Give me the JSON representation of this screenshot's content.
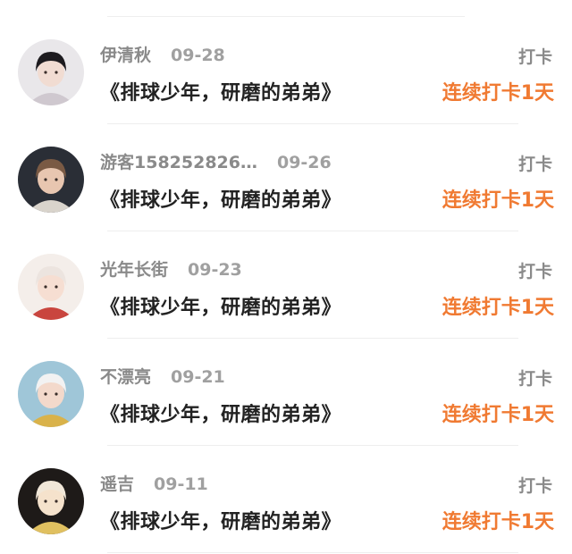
{
  "entries": [
    {
      "name": "伊清秋",
      "date": "09-28",
      "title": "《排球少年，研磨的弟弟》",
      "action": "打卡",
      "streak": "连续打卡1天",
      "avatar": {
        "icon": "avatar-dark-hair-man",
        "bg": "#e9e7ea",
        "hair": "#1d1b1f",
        "skin": "#f1dcd2",
        "cloth": "#cfc8cf"
      }
    },
    {
      "name": "游客158252826…",
      "date": "09-26",
      "title": "《排球少年，研磨的弟弟》",
      "action": "打卡",
      "streak": "连续打卡1天",
      "avatar": {
        "icon": "avatar-long-hair-woman",
        "bg": "#2a2e36",
        "hair": "#7a5a44",
        "skin": "#e8c6b0",
        "cloth": "#d9d4cc"
      }
    },
    {
      "name": "光年长街",
      "date": "09-23",
      "title": "《排球少年，研磨的弟弟》",
      "action": "打卡",
      "streak": "连续打卡1天",
      "avatar": {
        "icon": "avatar-white-hair-chibi",
        "bg": "#f4eeea",
        "hair": "#ece4df",
        "skin": "#f6ded2",
        "cloth": "#c9453e"
      }
    },
    {
      "name": "不漂亮",
      "date": "09-21",
      "title": "《排球少年，研磨的弟弟》",
      "action": "打卡",
      "streak": "连续打卡1天",
      "avatar": {
        "icon": "avatar-fantasy-character",
        "bg": "#9fc6d8",
        "hair": "#f2f2f2",
        "skin": "#f3d9cb",
        "cloth": "#d9b24a"
      }
    },
    {
      "name": "遥吉",
      "date": "09-11",
      "title": "《排球少年，研磨的弟弟》",
      "action": "打卡",
      "streak": "连续打卡1天",
      "avatar": {
        "icon": "avatar-light-angel",
        "bg": "#1e1a18",
        "hair": "#f1e7d8",
        "skin": "#f5e2cc",
        "cloth": "#e0c060"
      }
    }
  ]
}
